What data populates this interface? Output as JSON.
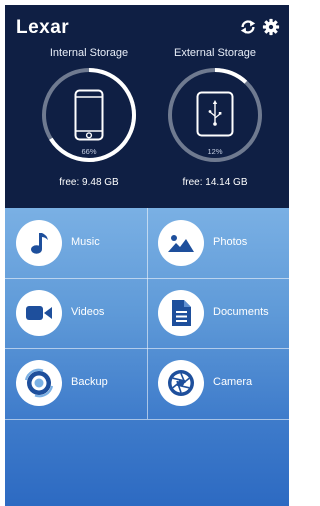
{
  "header": {
    "brand": "Lexar",
    "sync_icon": "sync-icon",
    "settings_icon": "gear-icon"
  },
  "storage": [
    {
      "title": "Internal Storage",
      "percent_label": "66%",
      "used_fraction": 0.66,
      "free_label": "free: 9.48 GB",
      "icon": "phone-icon"
    },
    {
      "title": "External Storage",
      "percent_label": "12%",
      "used_fraction": 0.12,
      "free_label": "free: 14.14 GB",
      "icon": "usb-drive-icon"
    }
  ],
  "menu": [
    {
      "label": "Music",
      "icon": "music-note-icon"
    },
    {
      "label": "Photos",
      "icon": "photo-icon"
    },
    {
      "label": "Videos",
      "icon": "video-camera-icon"
    },
    {
      "label": "Documents",
      "icon": "document-icon"
    },
    {
      "label": "Backup",
      "icon": "backup-icon"
    },
    {
      "label": "Camera",
      "icon": "camera-shutter-icon"
    }
  ],
  "colors": {
    "header_bg": "#0f1f44",
    "grid_top": "#7ab0e4",
    "grid_bottom": "#2d6ac2",
    "ring_track": "#6f7a90",
    "ring_fill": "#ffffff",
    "icon_blue": "#1e4f9c"
  }
}
